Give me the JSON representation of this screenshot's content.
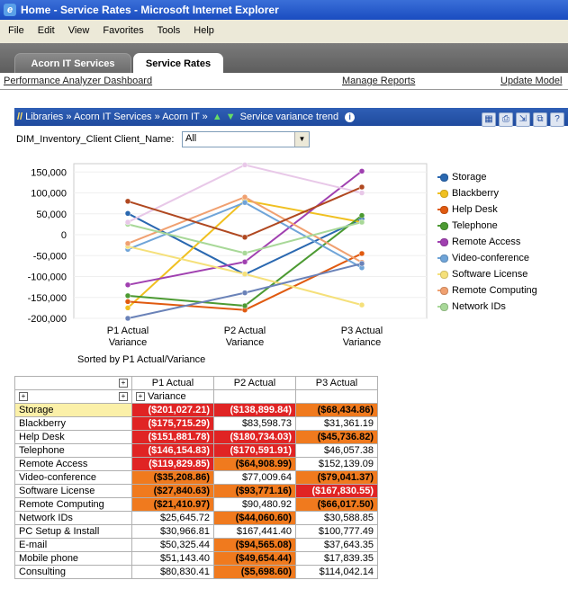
{
  "window": {
    "title": "Home - Service Rates - Microsoft Internet Explorer"
  },
  "menu": {
    "items": [
      "File",
      "Edit",
      "View",
      "Favorites",
      "Tools",
      "Help"
    ]
  },
  "tabs": [
    {
      "label": "Acorn IT Services",
      "active": false
    },
    {
      "label": "Service Rates",
      "active": true
    }
  ],
  "links": {
    "dashboard": "Performance Analyzer Dashboard",
    "manage": "Manage Reports",
    "update": "Update Model"
  },
  "breadcrumb": {
    "libraries": "Libraries",
    "sep": "»",
    "acorn_services": "Acorn IT Services",
    "acorn": "Acorn IT",
    "view": "Service variance trend"
  },
  "filter": {
    "label": "DIM_Inventory_Client Client_Name:",
    "value": "All"
  },
  "chart_data": {
    "type": "line",
    "x": [
      "P1 Actual Variance",
      "P2 Actual Variance",
      "P3 Actual Variance"
    ],
    "x_label_lines": [
      [
        "P1 Actual",
        "Variance"
      ],
      [
        "P2 Actual",
        "Variance"
      ],
      [
        "P3 Actual",
        "Variance"
      ]
    ],
    "ylim": [
      -200000,
      170000
    ],
    "yticks": [
      150000,
      100000,
      50000,
      0,
      -50000,
      -100000,
      -150000,
      -200000
    ],
    "ytick_labels": [
      "150,000",
      "100,000",
      "50,000",
      "0",
      "-50,000",
      "-100,000",
      "-150,000",
      "-200,000"
    ],
    "legend_position": "right",
    "series": [
      {
        "name": "Storage",
        "color": "#2a68b0",
        "values": [
          51000,
          -95000,
          38000
        ]
      },
      {
        "name": "Blackberry",
        "color": "#f0c020",
        "values": [
          -175000,
          82000,
          30000
        ]
      },
      {
        "name": "Help Desk",
        "color": "#e05a10",
        "values": [
          -160000,
          -180000,
          -45000
        ]
      },
      {
        "name": "Telephone",
        "color": "#4c9a32",
        "values": [
          -146000,
          -170000,
          46000
        ]
      },
      {
        "name": "Remote Access",
        "color": "#a040b0",
        "values": [
          -120000,
          -65000,
          152000
        ]
      },
      {
        "name": "Video-conference",
        "color": "#6fa4d8",
        "values": [
          -35000,
          77000,
          -79000
        ]
      },
      {
        "name": "Software License",
        "color": "#f5e07a",
        "values": [
          -28000,
          -94000,
          -168000
        ]
      },
      {
        "name": "Remote Computing",
        "color": "#f0a070",
        "values": [
          -21000,
          90000,
          -66000
        ]
      },
      {
        "name": "Network IDs",
        "color": "#a8d898",
        "values": [
          25000,
          -44000,
          30000
        ]
      },
      {
        "name": "",
        "color": "#6a82b8",
        "values": [
          -200000,
          -139000,
          -69000
        ]
      },
      {
        "name": "",
        "color": "#e8c8e8",
        "values": [
          30000,
          167000,
          100000
        ]
      },
      {
        "name": "",
        "color": "#b04820",
        "values": [
          80000,
          -6000,
          114000
        ]
      }
    ]
  },
  "sorted_note": "Sorted by P1 Actual/Variance",
  "grid": {
    "toggle": "+",
    "col_headers": [
      "P1 Actual",
      "P2 Actual",
      "P3 Actual"
    ],
    "variance_label": "Variance",
    "rows": [
      {
        "label": "Storage",
        "selected": true,
        "cells": [
          {
            "v": "($201,027.21)",
            "c": "red"
          },
          {
            "v": "($138,899.84)",
            "c": "red"
          },
          {
            "v": "($68,434.86)",
            "c": "org"
          }
        ]
      },
      {
        "label": "Blackberry",
        "cells": [
          {
            "v": "($175,715.29)",
            "c": "red"
          },
          {
            "v": "$83,598.73",
            "c": "plain"
          },
          {
            "v": "$31,361.19",
            "c": "plain"
          }
        ]
      },
      {
        "label": "Help Desk",
        "cells": [
          {
            "v": "($151,881.78)",
            "c": "red"
          },
          {
            "v": "($180,734.03)",
            "c": "red"
          },
          {
            "v": "($45,736.82)",
            "c": "org"
          }
        ]
      },
      {
        "label": "Telephone",
        "cells": [
          {
            "v": "($146,154.83)",
            "c": "red"
          },
          {
            "v": "($170,591.91)",
            "c": "red"
          },
          {
            "v": "$46,057.38",
            "c": "plain"
          }
        ]
      },
      {
        "label": "Remote Access",
        "cells": [
          {
            "v": "($119,829.85)",
            "c": "red"
          },
          {
            "v": "($64,908.99)",
            "c": "org"
          },
          {
            "v": "$152,139.09",
            "c": "plain"
          }
        ]
      },
      {
        "label": "Video-conference",
        "cells": [
          {
            "v": "($35,208.86)",
            "c": "org"
          },
          {
            "v": "$77,009.64",
            "c": "plain"
          },
          {
            "v": "($79,041.37)",
            "c": "org"
          }
        ]
      },
      {
        "label": "Software License",
        "cells": [
          {
            "v": "($27,840.63)",
            "c": "org"
          },
          {
            "v": "($93,771.16)",
            "c": "org"
          },
          {
            "v": "($167,830.55)",
            "c": "red"
          }
        ]
      },
      {
        "label": "Remote Computing",
        "cells": [
          {
            "v": "($21,410.97)",
            "c": "org"
          },
          {
            "v": "$90,480.92",
            "c": "plain"
          },
          {
            "v": "($66,017.50)",
            "c": "org"
          }
        ]
      },
      {
        "label": "Network IDs",
        "cells": [
          {
            "v": "$25,645.72",
            "c": "plain"
          },
          {
            "v": "($44,060.60)",
            "c": "org"
          },
          {
            "v": "$30,588.85",
            "c": "plain"
          }
        ]
      },
      {
        "label": "PC Setup & Install",
        "cells": [
          {
            "v": "$30,966.81",
            "c": "plain"
          },
          {
            "v": "$167,441.40",
            "c": "plain"
          },
          {
            "v": "$100,777.49",
            "c": "plain"
          }
        ]
      },
      {
        "label": "E-mail",
        "cells": [
          {
            "v": "$50,325.44",
            "c": "plain"
          },
          {
            "v": "($94,565.08)",
            "c": "org"
          },
          {
            "v": "$37,643.35",
            "c": "plain"
          }
        ]
      },
      {
        "label": "Mobile phone",
        "cells": [
          {
            "v": "$51,143.40",
            "c": "plain"
          },
          {
            "v": "($49,654.44)",
            "c": "org"
          },
          {
            "v": "$17,839.35",
            "c": "plain"
          }
        ]
      },
      {
        "label": "Consulting",
        "cells": [
          {
            "v": "$80,830.41",
            "c": "plain"
          },
          {
            "v": "($5,698.60)",
            "c": "org"
          },
          {
            "v": "$114,042.14",
            "c": "plain"
          }
        ]
      }
    ]
  }
}
